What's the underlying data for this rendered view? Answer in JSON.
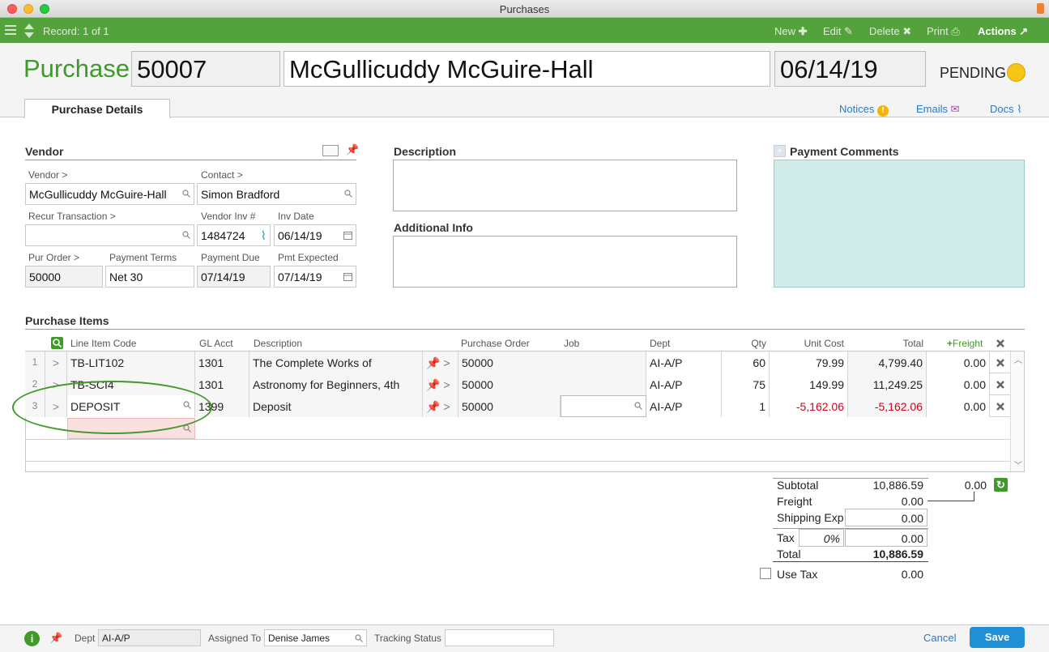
{
  "window": {
    "title": "Purchases"
  },
  "toolbar": {
    "record": "Record: 1 of 1",
    "new": "New",
    "edit": "Edit",
    "delete": "Delete",
    "print": "Print",
    "actions": "Actions"
  },
  "header": {
    "label": "Purchase:",
    "number": "50007",
    "vendor": "McGullicuddy McGuire-Hall",
    "date": "06/14/19",
    "status": "PENDING",
    "status_color": "#f5c518"
  },
  "tabs": {
    "details": "Purchase Details",
    "notices": "Notices",
    "emails": "Emails",
    "docs": "Docs"
  },
  "vendor_section": {
    "title": "Vendor",
    "vendor_label": "Vendor >",
    "vendor_value": "McGullicuddy McGuire-Hall",
    "contact_label": "Contact >",
    "contact_value": "Simon Bradford",
    "recur_label": "Recur Transaction >",
    "recur_value": "",
    "vendor_inv_label": "Vendor Inv #",
    "vendor_inv_value": "1484724",
    "inv_date_label": "Inv Date",
    "inv_date_value": "06/14/19",
    "pur_order_label": "Pur Order >",
    "pur_order_value": "50000",
    "terms_label": "Payment Terms",
    "terms_value": "Net 30",
    "due_label": "Payment Due",
    "due_value": "07/14/19",
    "expected_label": "Pmt Expected",
    "expected_value": "07/14/19"
  },
  "description": {
    "title": "Description",
    "value": ""
  },
  "additional": {
    "title": "Additional Info",
    "value": ""
  },
  "payment_comments": {
    "title": "Payment Comments",
    "value": ""
  },
  "items": {
    "title": "Purchase Items",
    "columns": {
      "code": "Line Item Code",
      "gl": "GL Acct",
      "desc": "Description",
      "po": "Purchase Order",
      "job": "Job",
      "dept": "Dept",
      "qty": "Qty",
      "unit": "Unit Cost",
      "total": "Total",
      "freight": "Freight"
    },
    "rows": [
      {
        "n": "1",
        "code": "TB-LIT102",
        "gl": "1301",
        "desc": "The Complete Works of",
        "po": "50000",
        "job": "",
        "dept": "AI-A/P",
        "qty": "60",
        "unit": "79.99",
        "total": "4,799.40",
        "freight": "0.00"
      },
      {
        "n": "2",
        "code": "TB-SCI4",
        "gl": "1301",
        "desc": "Astronomy for Beginners, 4th",
        "po": "50000",
        "job": "",
        "dept": "AI-A/P",
        "qty": "75",
        "unit": "149.99",
        "total": "11,249.25",
        "freight": "0.00"
      },
      {
        "n": "3",
        "code": "DEPOSIT",
        "gl": "1399",
        "desc": "Deposit",
        "po": "50000",
        "job": "",
        "dept": "AI-A/P",
        "qty": "1",
        "unit": "-5,162.06",
        "total": "-5,162.06",
        "freight": "0.00"
      }
    ]
  },
  "totals": {
    "subtotal_label": "Subtotal",
    "subtotal": "10,886.59",
    "freight_total": "0.00",
    "freight_label": "Freight",
    "freight": "0.00",
    "shipping_label": "Shipping Exp",
    "shipping": "0.00",
    "tax_label": "Tax",
    "tax_rate": "0%",
    "tax": "0.00",
    "total_label": "Total",
    "total": "10,886.59",
    "use_tax_label": "Use Tax",
    "use_tax": "0.00"
  },
  "footer": {
    "dept_label": "Dept",
    "dept_value": "AI-A/P",
    "assigned_label": "Assigned To",
    "assigned_value": "Denise James",
    "tracking_label": "Tracking Status",
    "tracking_value": "",
    "cancel": "Cancel",
    "save": "Save"
  }
}
